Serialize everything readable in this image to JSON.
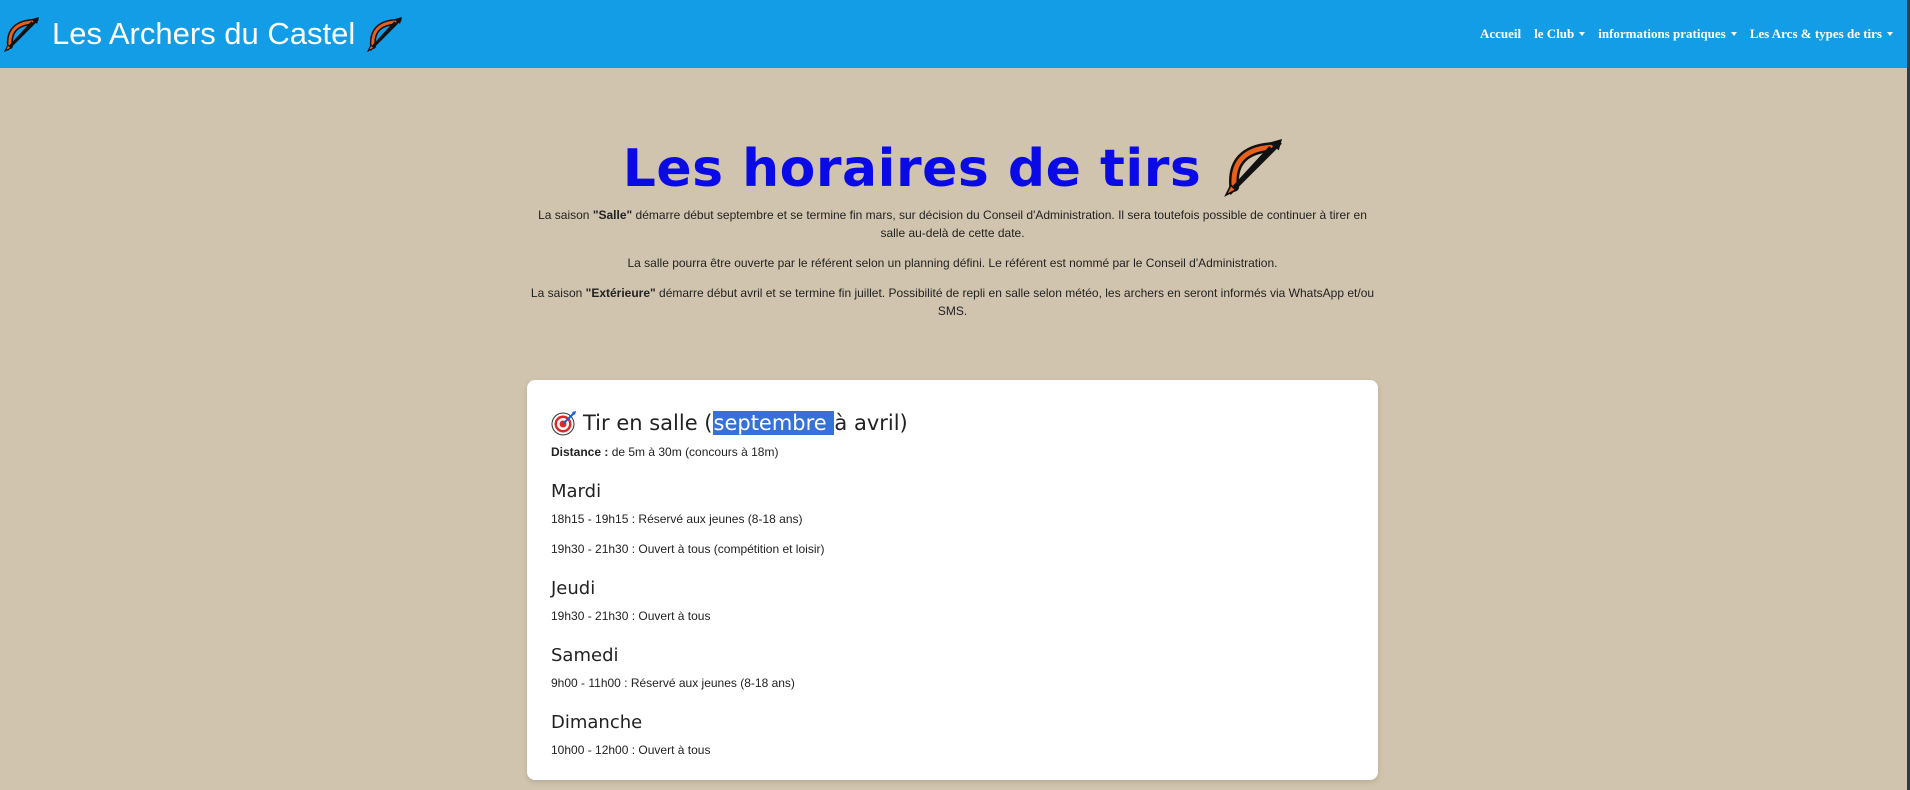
{
  "nav": {
    "brand": "Les Archers du Castel",
    "items": [
      {
        "label": "Accueil",
        "dropdown": false
      },
      {
        "label": "le Club",
        "dropdown": true
      },
      {
        "label": "informations pratiques",
        "dropdown": true
      },
      {
        "label": "Les Arcs & types de tirs",
        "dropdown": true
      }
    ],
    "color": "#139de6"
  },
  "page": {
    "title": "Les horaires de tirs",
    "title_color": "#0a0ae6",
    "intro_1_prefix": "La saison ",
    "intro_1_bold": "\"Salle\"",
    "intro_1_suffix": " démarre début septembre et se termine fin mars, sur décision du Conseil d'Administration. Il sera toutefois possible de continuer à tirer en salle au-delà de cette date.",
    "intro_2": "La salle pourra être ouverte par le référent selon un planning défini. Le référent est nommé par le Conseil d'Administration.",
    "intro_3_prefix": "La saison ",
    "intro_3_bold": "\"Extérieure\"",
    "intro_3_suffix": " démarre début avril et se termine fin juillet. Possibilité de repli en salle selon météo, les archers en seront informés via WhatsApp et/ou SMS."
  },
  "card": {
    "title_prefix": "Tir en salle (",
    "title_selected": "septembre ",
    "title_suffix": "à avril)",
    "distance_label": "Distance :",
    "distance_value": " de 5m à 30m (concours à 18m)",
    "days": [
      {
        "name": "Mardi",
        "slots": [
          "18h15 - 19h15 : Réservé aux jeunes (8-18 ans)",
          "19h30 - 21h30 : Ouvert à tous (compétition et loisir)"
        ]
      },
      {
        "name": "Jeudi",
        "slots": [
          "19h30 - 21h30 : Ouvert à tous"
        ]
      },
      {
        "name": "Samedi",
        "slots": [
          "9h00 - 11h00 : Réservé aux jeunes (8-18 ans)"
        ]
      },
      {
        "name": "Dimanche",
        "slots": [
          "10h00 - 12h00 : Ouvert à tous"
        ]
      }
    ]
  },
  "icons": {
    "brand": "bow-and-arrow-icon",
    "title": "bow-and-arrow-icon",
    "card": "target-icon"
  }
}
